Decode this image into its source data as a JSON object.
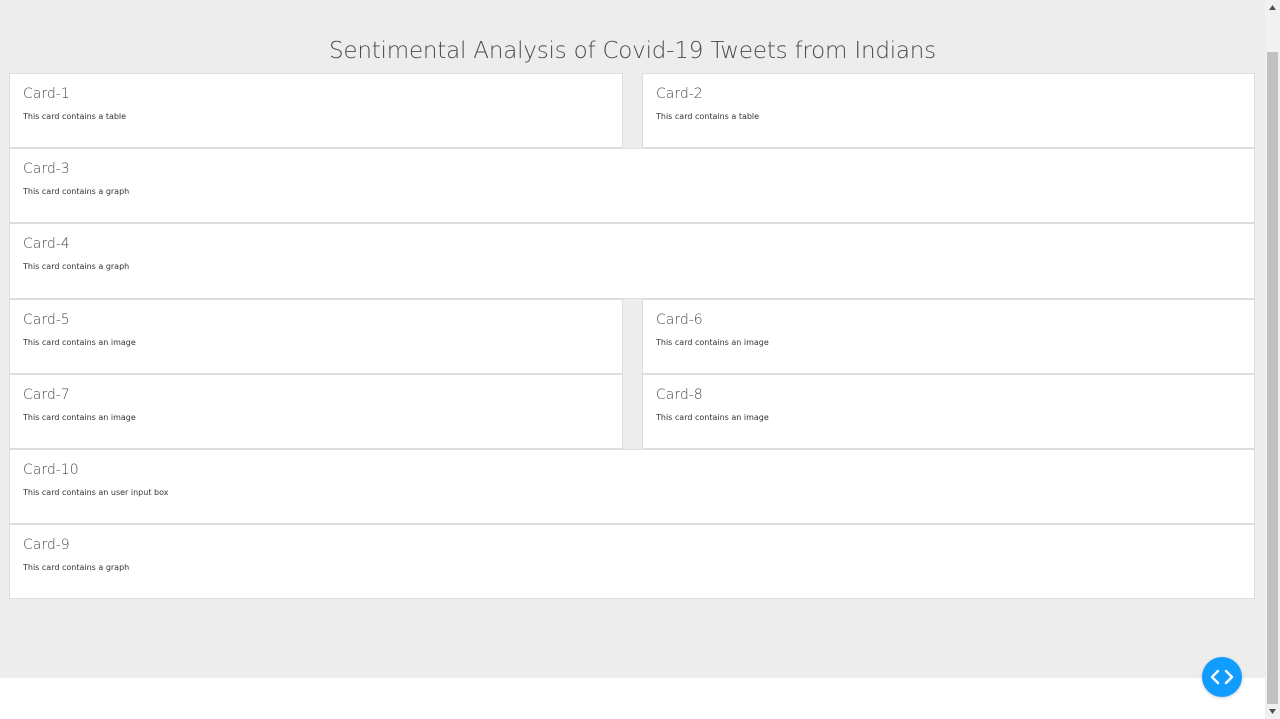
{
  "page": {
    "title": "Sentimental Analysis of Covid-19 Tweets from Indians"
  },
  "cards": [
    {
      "title": "Card-1",
      "desc": "This card contains a table"
    },
    {
      "title": "Card-2",
      "desc": "This card contains a table"
    },
    {
      "title": "Card-3",
      "desc": "This card contains a graph"
    },
    {
      "title": "Card-4",
      "desc": "This card contains a graph"
    },
    {
      "title": "Card-5",
      "desc": "This card contains an image"
    },
    {
      "title": "Card-6",
      "desc": "This card contains an image"
    },
    {
      "title": "Card-7",
      "desc": "This card contains an image"
    },
    {
      "title": "Card-8",
      "desc": "This card contains an image"
    },
    {
      "title": "Card-10",
      "desc": "This card contains an user input box"
    },
    {
      "title": "Card-9",
      "desc": "This card contains a graph"
    }
  ],
  "icons": {
    "fab": "code-brackets-icon",
    "scroll_up": "triangle-up-icon",
    "scroll_down": "triangle-down-icon"
  },
  "colors": {
    "background": "#ededed",
    "card": "#ffffff",
    "fab": "#119dff"
  }
}
